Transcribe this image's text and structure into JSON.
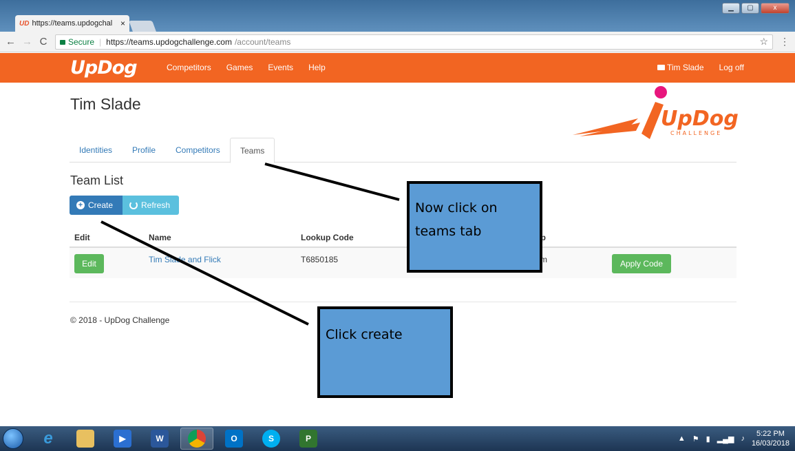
{
  "browser": {
    "tab_title": "https://teams.updogchal",
    "tab_favicon": "UD",
    "tab_close": "×",
    "url_secure_label": "Secure",
    "url_host": "https://teams.updogchallenge.com",
    "url_path": "/account/teams",
    "window_buttons": [
      "▁",
      "▢",
      "x"
    ]
  },
  "nav": {
    "logo": "UpDog",
    "links": [
      "Competitors",
      "Games",
      "Events",
      "Help"
    ],
    "user": "Tim Slade",
    "logoff": "Log off"
  },
  "page": {
    "username": "Tim Slade",
    "tabs": [
      "Identities",
      "Profile",
      "Competitors",
      "Teams"
    ],
    "active_tab": "Teams",
    "section_title": "Team List",
    "create_label": "Create",
    "refresh_label": "Refresh",
    "brand_logo_text": "UpDog",
    "brand_logo_sub": "CHALLENGE",
    "table": {
      "headers": [
        "Edit",
        "Name",
        "Lookup Code",
        "hip"
      ],
      "rows": [
        {
          "edit": "Edit",
          "name": "Tim Slade and Flick",
          "lookup_code": "T6850185",
          "ownership": "m",
          "action": "Apply Code"
        }
      ]
    },
    "footer": "© 2018 - UpDog Challenge"
  },
  "annotations": {
    "callout1": "Now click on teams tab",
    "callout2": "Click create"
  },
  "taskbar": {
    "apps": [
      "ie-icon",
      "explorer-icon",
      "media-player-icon",
      "word-icon",
      "chrome-icon",
      "outlook-icon",
      "skype-icon",
      "project-icon"
    ],
    "time": "5:22 PM",
    "date": "16/03/2018"
  },
  "colors": {
    "nav_orange": "#f26522",
    "primary": "#337ab7",
    "info": "#5bc0de",
    "success": "#5cb85c",
    "callout": "#5b9bd5"
  }
}
